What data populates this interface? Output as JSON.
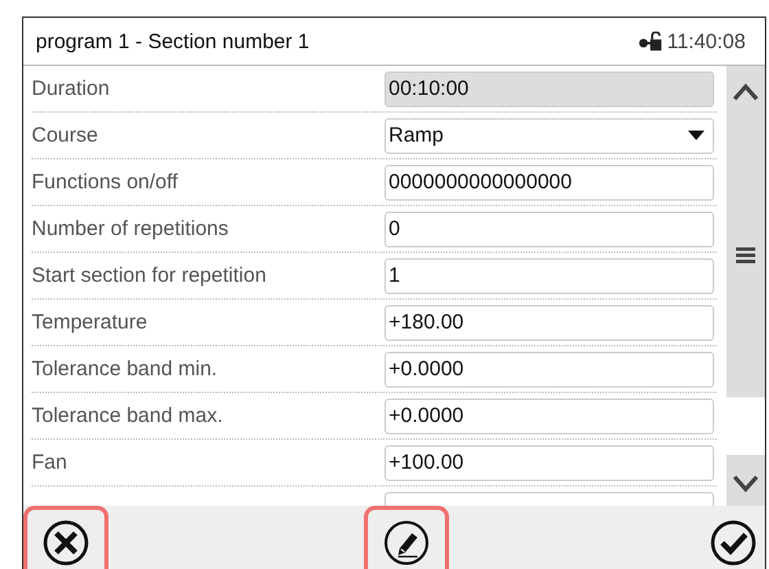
{
  "header": {
    "title": "program 1 - Section number 1",
    "time": "11:40:08"
  },
  "rows": [
    {
      "label": "Duration",
      "kind": "readonly",
      "value": "00:10:00"
    },
    {
      "label": "Course",
      "kind": "dropdown",
      "value": "Ramp"
    },
    {
      "label": "Functions on/off",
      "kind": "input",
      "value": "0000000000000000"
    },
    {
      "label": "Number of repetitions",
      "kind": "input",
      "value": "0"
    },
    {
      "label": "Start section for repetition",
      "kind": "input",
      "value": "1"
    },
    {
      "label": "Temperature",
      "kind": "input",
      "value": "+180.00"
    },
    {
      "label": "Tolerance band min.",
      "kind": "input",
      "value": "+0.0000"
    },
    {
      "label": "Tolerance band max.",
      "kind": "input",
      "value": "+0.0000"
    },
    {
      "label": "Fan",
      "kind": "input",
      "value": "+100.00"
    },
    {
      "kind": "input"
    }
  ],
  "toolbar": [
    {
      "kind": "cancel",
      "highlighted": true
    },
    {
      "kind": "edit",
      "highlighted": true
    },
    {
      "kind": "confirm",
      "highlighted": false
    }
  ]
}
